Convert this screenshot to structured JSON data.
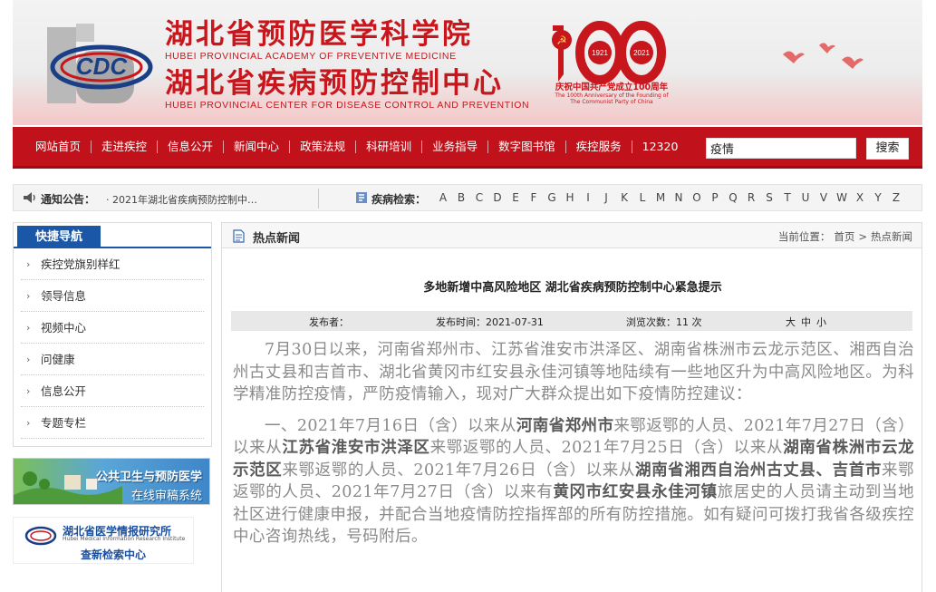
{
  "header": {
    "title_cn_1": "湖北省预防医学科学院",
    "title_en_1": "HUBEI PROVINCIAL ACADEMY OF PREVENTIVE MEDICINE",
    "title_cn_2": "湖北省疾病预防控制中心",
    "title_en_2": "HUBEI PROVINCIAL CENTER FOR DISEASE CONTROL AND PREVENTION",
    "logo_letters": "CDC",
    "centenary_years_1": "1921",
    "centenary_years_2": "2021",
    "centenary_number": "100",
    "centenary_cn": "庆祝中国共产党成立100周年",
    "centenary_en_1": "The 100th Anniversary of the Founding of",
    "centenary_en_2": "The Communist Party of China"
  },
  "nav": {
    "items": [
      "网站首页",
      "走进疾控",
      "信息公开",
      "新闻中心",
      "政策法规",
      "科研培训",
      "业务指导",
      "数字图书馆",
      "疾控服务",
      "12320"
    ],
    "search_value": "疫情",
    "search_button": "搜索"
  },
  "notice": {
    "label": "通知公告：",
    "text": "· 2021年湖北省疾病预防控制中…",
    "index_label": "疾病检索：",
    "letters": [
      "A",
      "B",
      "C",
      "D",
      "E",
      "F",
      "G",
      "H",
      "I",
      "J",
      "K",
      "L",
      "M",
      "N",
      "O",
      "P",
      "Q",
      "R",
      "S",
      "T",
      "U",
      "V",
      "W",
      "X",
      "Y",
      "Z"
    ]
  },
  "sidebar": {
    "title": "快捷导航",
    "items": [
      "疾控党旗别样红",
      "领导信息",
      "视频中心",
      "问健康",
      "信息公开",
      "专题专栏"
    ],
    "promo1_line1": "公共卫生与预防医学",
    "promo1_line2": "在线审稿系统",
    "promo2_title": "湖北省医学情报研究所",
    "promo2_en": "Hubei Medical Information Research Institute",
    "promo2_sub": "查新检索中心"
  },
  "main": {
    "section_title": "热点新闻",
    "crumb_label": "当前位置：",
    "crumb_home": "首页",
    "crumb_sep": ">",
    "crumb_current": "热点新闻",
    "article_title": "多地新增中高风险地区 湖北省疾病预防控制中心紧急提示",
    "publisher_label": "发布者：",
    "publish_time": "发布时间：2021-07-31",
    "views": "浏览次数：11 次",
    "size_large": "大",
    "size_medium": "中",
    "size_small": "小",
    "para1": "7月30日以来，河南省郑州市、江苏省淮安市洪泽区、湖南省株洲市云龙示范区、湘西自治州古丈县和吉首市、湖北省黄冈市红安县永佳河镇等地陆续有一些地区升为中高风险地区。为科学精准防控疫情，严防疫情输入，现对广大群众提出如下疫情防控建议：",
    "para2_segments": [
      {
        "t": "一、2021年7月16日（含）以来从",
        "b": false
      },
      {
        "t": "河南省郑州市",
        "b": true
      },
      {
        "t": "来鄂返鄂的人员、2021年7月27日（含）以来从",
        "b": false
      },
      {
        "t": "江苏省淮安市洪泽区",
        "b": true
      },
      {
        "t": "来鄂返鄂的人员、2021年7月25日（含）以来从",
        "b": false
      },
      {
        "t": "湖南省株洲市云龙示范区",
        "b": true
      },
      {
        "t": "来鄂返鄂的人员、2021年7月26日（含）以来从",
        "b": false
      },
      {
        "t": "湖南省湘西自治州古丈县、吉首市",
        "b": true
      },
      {
        "t": "来鄂返鄂的人员、2021年7月27日（含）以来有",
        "b": false
      },
      {
        "t": "黄冈市红安县永佳河镇",
        "b": true
      },
      {
        "t": "旅居史的人员请主动到当地社区进行健康申报，并配合当地疫情防控指挥部的所有防控措施。如有疑问可拨打我省各级疾控中心咨询热线，号码附后。",
        "b": false
      }
    ]
  },
  "colors": {
    "brand_red": "#c1121b",
    "title_red": "#c8161d",
    "nav_blue": "#1a57a7"
  }
}
